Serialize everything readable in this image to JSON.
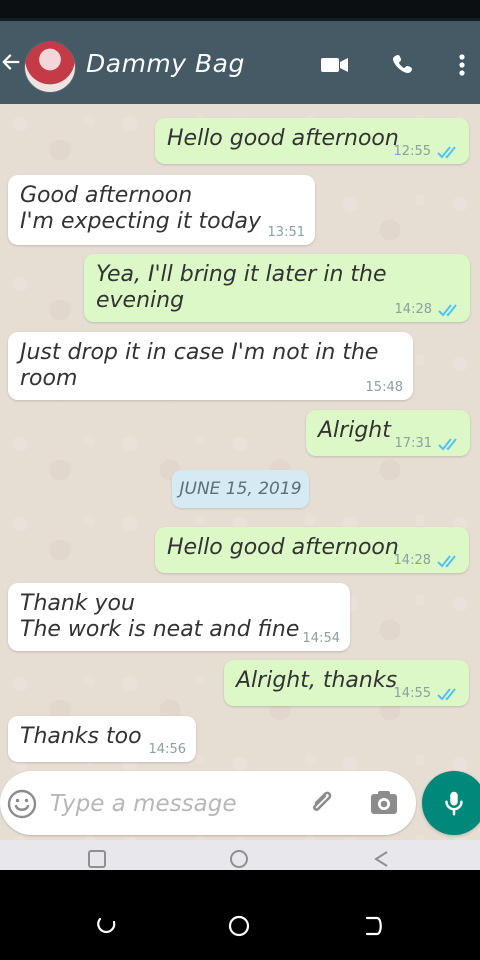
{
  "header": {
    "contact_name": "Dammy Bag",
    "icons": [
      "back-arrow-icon",
      "video-call-icon",
      "phone-call-icon",
      "more-options-icon"
    ],
    "bar_color": "#455a64"
  },
  "messages": [
    {
      "direction": "out",
      "text": "Hello good afternoon",
      "time": "12:55",
      "read": true
    },
    {
      "direction": "in",
      "text": "Good afternoon\nI'm expecting it today",
      "time": "13:51"
    },
    {
      "direction": "out",
      "text": "Yea, I'll bring it later in the evening",
      "time": "14:28",
      "read": true
    },
    {
      "direction": "in",
      "text": "Just drop it in case I'm not in the\nroom",
      "time": "15:48"
    },
    {
      "direction": "out",
      "text": "Alright",
      "time": "17:31",
      "read": true
    },
    {
      "direction": "out",
      "text": "Hello good afternoon",
      "time": "14:28",
      "read": true
    },
    {
      "direction": "in",
      "text": "Thank you\nThe work is neat and fine",
      "time": "14:54"
    },
    {
      "direction": "out",
      "text": "Alright, thanks",
      "time": "14:55",
      "read": true
    },
    {
      "direction": "in",
      "text": "Thanks too",
      "time": "14:56"
    }
  ],
  "date_separator": "JUNE 15, 2019",
  "composer": {
    "placeholder": "Type a message",
    "icons": [
      "emoji-icon",
      "attach-icon",
      "camera-icon",
      "mic-icon"
    ],
    "send_button_color": "#00897b"
  },
  "navigation": {
    "icons": [
      "recent-apps-icon",
      "home-icon",
      "back-icon"
    ]
  },
  "colors": {
    "outgoing_bubble": "#dcf8c6",
    "incoming_bubble": "#ffffff",
    "read_tick": "#4fc3f7",
    "chat_background": "#e6ddd3"
  }
}
